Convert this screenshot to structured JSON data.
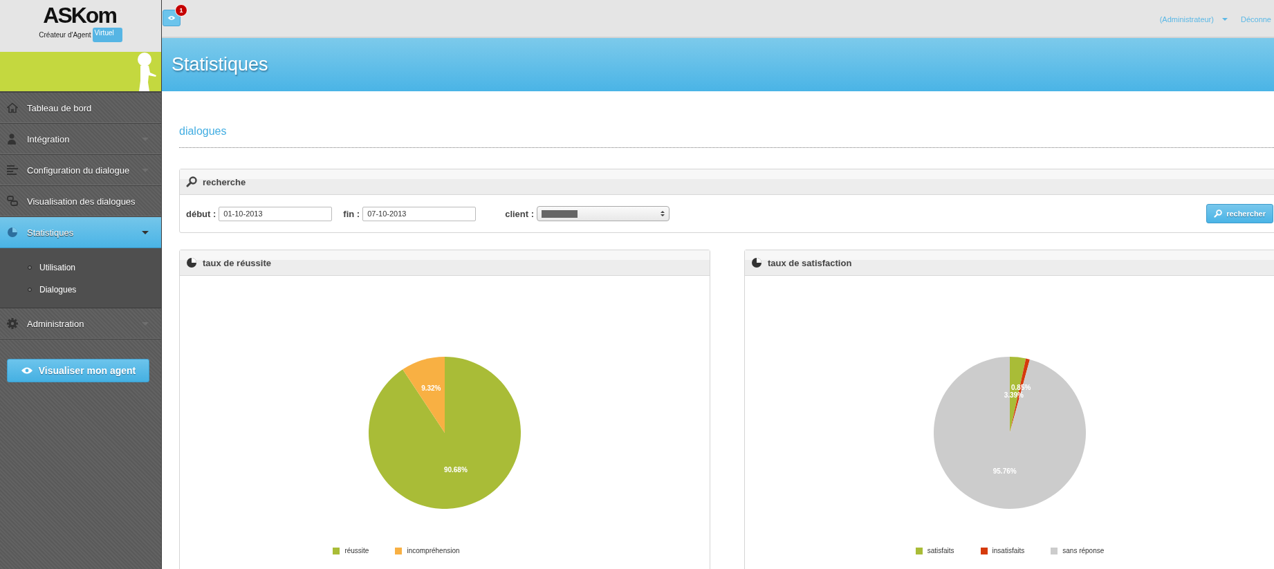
{
  "logo": {
    "name": "ASKom",
    "tagline": "Créateur d'Agent",
    "badge": "Virtuel"
  },
  "notifications": {
    "count": "1"
  },
  "user_menu": {
    "role": "(Administrateur)",
    "logout": "Déconne"
  },
  "page_title": "Statistiques",
  "sidebar": {
    "items": [
      {
        "label": "Tableau de bord",
        "expandable": false,
        "selected": false
      },
      {
        "label": "Intégration",
        "expandable": true,
        "selected": false
      },
      {
        "label": "Configuration du dialogue",
        "expandable": true,
        "selected": false
      },
      {
        "label": "Visualisation des dialogues",
        "expandable": false,
        "selected": false
      },
      {
        "label": "Statistiques",
        "expandable": true,
        "selected": true,
        "children": [
          {
            "label": "Utilisation"
          },
          {
            "label": "Dialogues"
          }
        ]
      },
      {
        "label": "Administration",
        "expandable": true,
        "selected": false
      }
    ],
    "action_button": "Visualiser mon agent"
  },
  "section_title": "dialogues",
  "search": {
    "title": "recherche",
    "start_label": "début :",
    "start_value": "01-10-2013",
    "end_label": "fin :",
    "end_value": "07-10-2013",
    "client_label": "client :",
    "button": "rechercher"
  },
  "charts": [
    {
      "title": "taux de réussite",
      "chart_data": {
        "type": "pie",
        "categories": [
          "réussite",
          "incompréhension"
        ],
        "values": [
          90.68,
          9.32
        ],
        "colors": [
          "#a9bc37",
          "#f8b043"
        ],
        "legend": "bottom",
        "value_labels": [
          "90.68%",
          "9.32%"
        ]
      }
    },
    {
      "title": "taux de satisfaction",
      "chart_data": {
        "type": "pie",
        "categories": [
          "satisfaits",
          "insatisfaits",
          "sans réponse"
        ],
        "values": [
          3.39,
          0.85,
          95.76
        ],
        "colors": [
          "#a9bc37",
          "#d53a0c",
          "#cccccc"
        ],
        "legend": "bottom",
        "value_labels": [
          "3.39%",
          "0.85%",
          "95.76%"
        ]
      }
    }
  ]
}
